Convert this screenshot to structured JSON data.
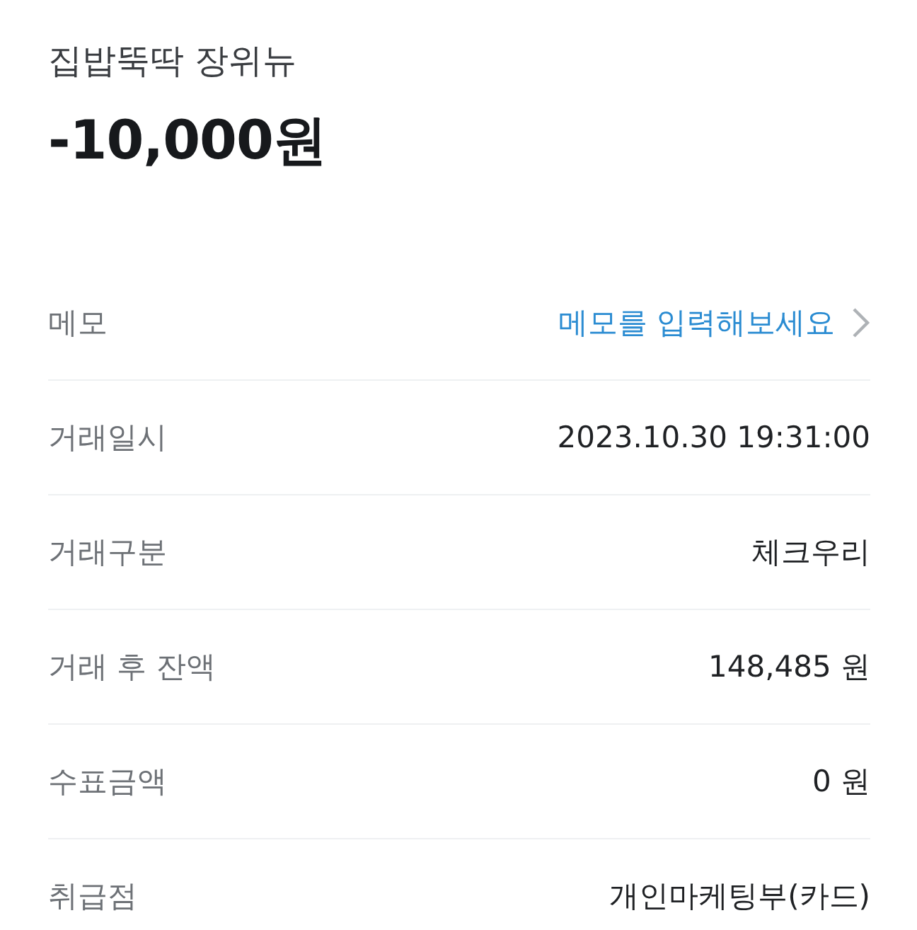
{
  "merchant": "집밥뚝딱 장위뉴",
  "amount": "-10,000원",
  "details": [
    {
      "kind": "link",
      "label": "메모",
      "value": "메모를 입력해보세요"
    },
    {
      "kind": "text",
      "label": "거래일시",
      "value": "2023.10.30 19:31:00"
    },
    {
      "kind": "text",
      "label": "거래구분",
      "value": "체크우리"
    },
    {
      "kind": "text",
      "label": "거래 후 잔액",
      "value": "148,485 원"
    },
    {
      "kind": "text",
      "label": "수표금액",
      "value": "0 원"
    },
    {
      "kind": "text",
      "label": "취급점",
      "value": "개인마케팅부(카드)"
    }
  ]
}
